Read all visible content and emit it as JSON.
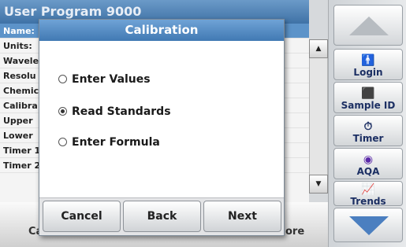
{
  "background": {
    "header_title": "User Program  9000",
    "rows": [
      "Name: ",
      "Units: ",
      "Wavele",
      "Resolu",
      "Chemic",
      "Calibra",
      "Upper",
      "Lower",
      "Timer 1",
      "Timer 2"
    ],
    "bottom_left": "Ca",
    "bottom_right": "ore"
  },
  "sidebar": {
    "login": "Login",
    "sample_id": "Sample ID",
    "timer": "Timer",
    "aqa": "AQA",
    "trends": "Trends"
  },
  "dialog": {
    "title": "Calibration",
    "options": [
      "Enter Values",
      "Read Standards",
      "Enter Formula"
    ],
    "selected_index": 1,
    "cancel": "Cancel",
    "back": "Back",
    "next": "Next"
  },
  "colors": {
    "title_bar": "#4f86c0",
    "selected_row": "#5c93c9",
    "arrow_down": "#4b7fc0"
  }
}
